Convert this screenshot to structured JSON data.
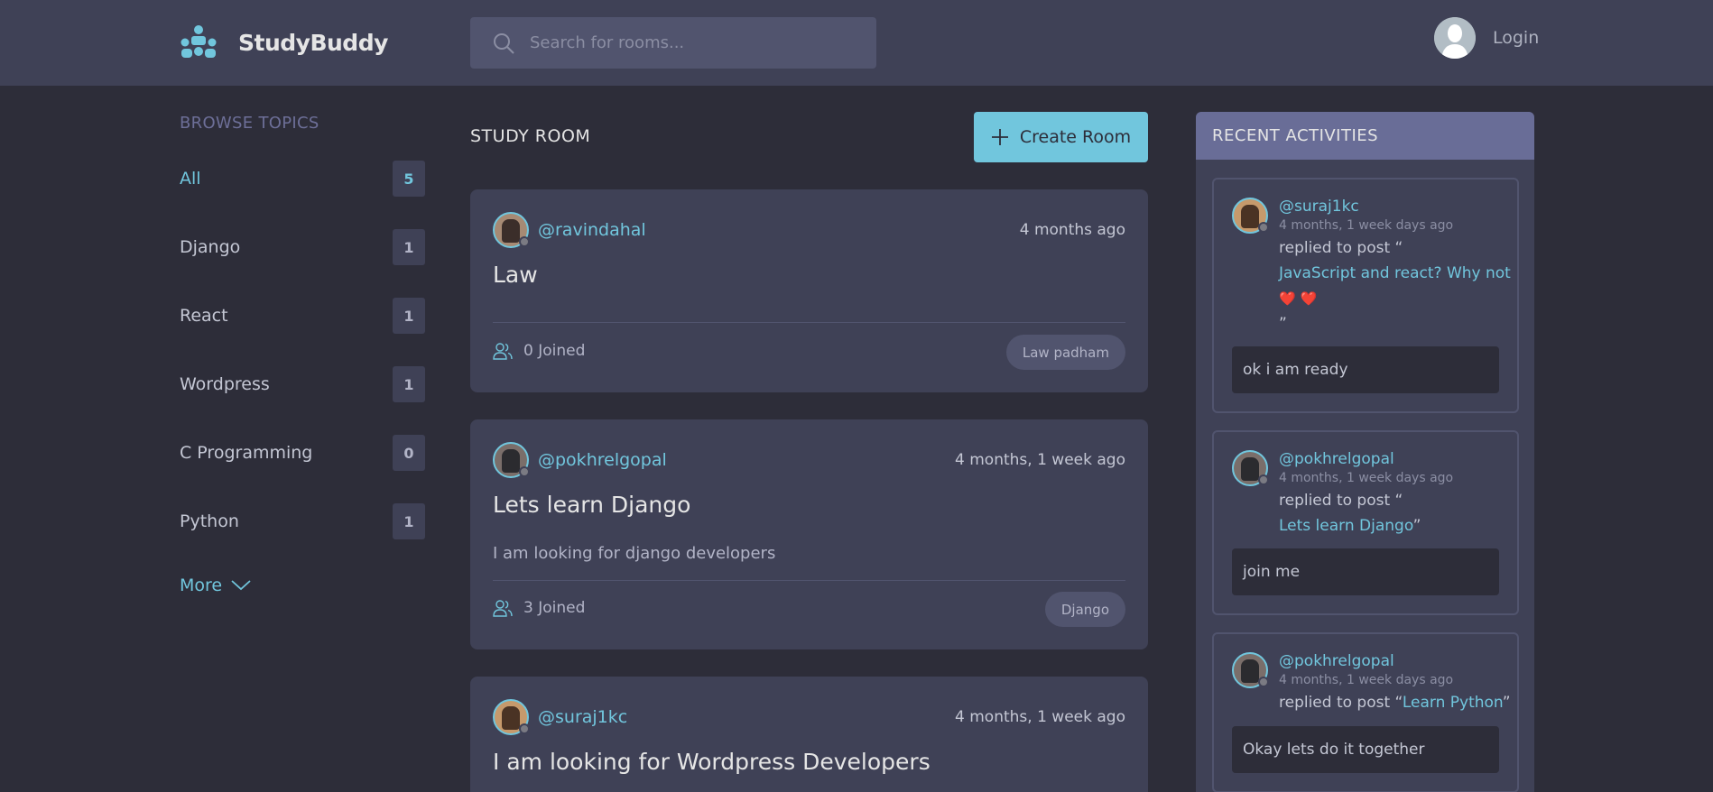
{
  "header": {
    "app_name": "StudyBuddy",
    "search_placeholder": "Search for rooms...",
    "login_label": "Login"
  },
  "sidebar": {
    "title": "BROWSE TOPICS",
    "topics": [
      {
        "name": "All",
        "count": "5",
        "active": true
      },
      {
        "name": "Django",
        "count": "1"
      },
      {
        "name": "React",
        "count": "1"
      },
      {
        "name": "Wordpress",
        "count": "1"
      },
      {
        "name": "C Programming",
        "count": "0"
      },
      {
        "name": "Python",
        "count": "1"
      }
    ],
    "more_label": "More"
  },
  "feed": {
    "title": "STUDY ROOM",
    "create_label": "Create Room",
    "rooms": [
      {
        "host": "@ravindahal",
        "time": "4 months ago",
        "title": "Law",
        "description": "",
        "joined": "0 Joined",
        "topic": "Law padham"
      },
      {
        "host": "@pokhrelgopal",
        "time": "4 months, 1 week ago",
        "title": "Lets learn Django",
        "description": "I am looking for django developers",
        "joined": "3 Joined",
        "topic": "Django"
      },
      {
        "host": "@suraj1kc",
        "time": "4 months, 1 week ago",
        "title": "I am looking for Wordpress Developers",
        "description": "",
        "joined": "",
        "topic": ""
      }
    ]
  },
  "activity": {
    "title": "RECENT ACTIVITIES",
    "items": [
      {
        "user": "@suraj1kc",
        "time": "4 months, 1 week days ago",
        "action": "replied to post “",
        "post": "JavaScript and react? Why not",
        "extra": "❤️ ❤️",
        "close": "”",
        "message": "ok i am ready"
      },
      {
        "user": "@pokhrelgopal",
        "time": "4 months, 1 week days ago",
        "action": "replied to post “",
        "post": "Lets learn Django",
        "close": "”",
        "message": "join me"
      },
      {
        "user": "@pokhrelgopal",
        "time": "4 months, 1 week days ago",
        "action": "replied to post “",
        "post": "Learn Python",
        "close": "”",
        "message": "Okay lets do it together"
      }
    ]
  },
  "colors": {
    "background": "#2d2d39",
    "header": "#3f4156",
    "accent": "#71c6dd",
    "panel_header": "#696d97"
  },
  "icons": [
    "studybuddy-logo-icon",
    "search-icon",
    "user-icon",
    "plus-icon",
    "chevron-down-icon",
    "users-icon"
  ]
}
